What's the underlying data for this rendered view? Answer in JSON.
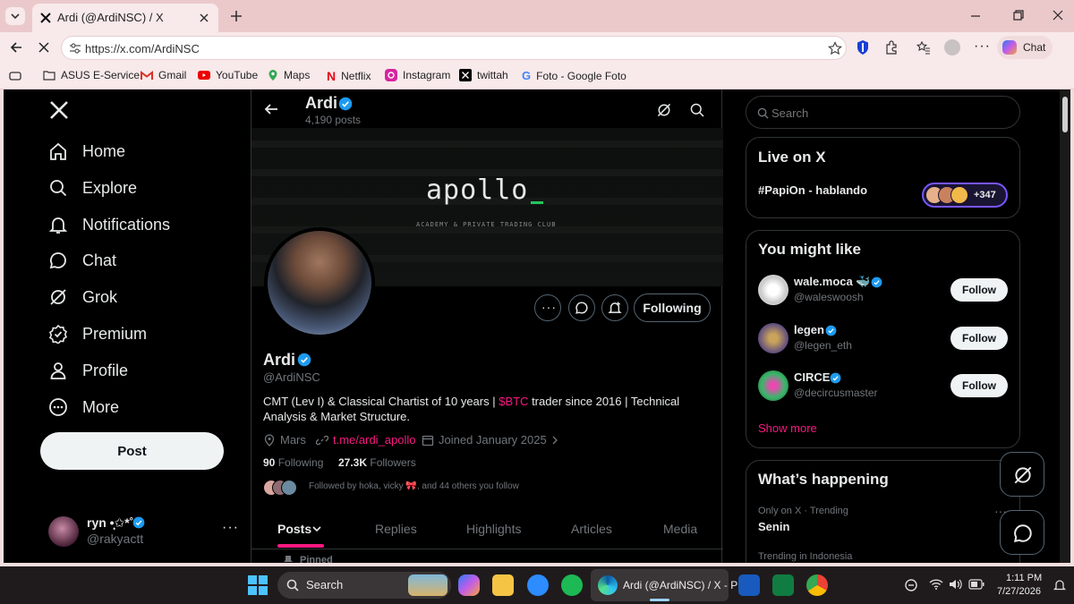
{
  "browser": {
    "tab_title": "Ardi (@ArdiNSC) / X",
    "url": "https://x.com/ArdiNSC",
    "chat_label": "Chat",
    "bookmarks": [
      "ASUS E-Service",
      "Gmail",
      "YouTube",
      "Maps",
      "Netflix",
      "Instagram",
      "twittah",
      "Foto - Google Foto"
    ]
  },
  "sidebar": {
    "items": [
      "Home",
      "Explore",
      "Notifications",
      "Chat",
      "Grok",
      "Premium",
      "Profile",
      "More"
    ],
    "post_label": "Post",
    "account_name": "ryn •̩͙✩*˚",
    "account_handle": "@rakyactt",
    "more_dots": "···"
  },
  "header": {
    "name": "Ardi",
    "posts_count": "4,190 posts"
  },
  "banner": {
    "logo": "apollo",
    "tagline": "ACADEMY & PRIVATE TRADING CLUB"
  },
  "profile": {
    "name": "Ardi",
    "handle": "@ArdiNSC",
    "bio_1": "CMT (Lev I) & Classical Chartist of 10 years | ",
    "bio_cashtag": "$BTC",
    "bio_2": " trader since 2016 | Technical Analysis & Market Structure.",
    "location": "Mars",
    "link": "t.me/ardi_apollo",
    "joined": "Joined January 2025",
    "following_count": "90",
    "following_label": "Following",
    "followers_count": "27.3K",
    "followers_label": "Followers",
    "followed_by": "Followed by hoka, vicky 🎀, and 44 others you follow",
    "following_button": "Following",
    "more_dots": "···"
  },
  "tabs": [
    "Posts",
    "Replies",
    "Highlights",
    "Articles",
    "Media"
  ],
  "pinned_label": "Pinned",
  "right": {
    "search_placeholder": "Search",
    "live": {
      "title": "Live on X",
      "topic": "#PapiOn - hablando",
      "count": "+347"
    },
    "suggest": {
      "title": "You might like",
      "users": [
        {
          "name": "wale.moca 🐳",
          "handle": "@waleswoosh",
          "button": "Follow"
        },
        {
          "name": "legen",
          "handle": "@legen_eth",
          "button": "Follow"
        },
        {
          "name": "CIRCE",
          "handle": "@decircusmaster",
          "button": "Follow"
        }
      ],
      "show_more": "Show more"
    },
    "happening": {
      "title": "What’s happening",
      "trend_context": "Only on X · Trending",
      "trend_name": "Senin",
      "trend2_context": "Trending in Indonesia",
      "dots": "···"
    }
  },
  "taskbar": {
    "search": "Search",
    "app_label": "Ardi (@ArdiNSC) / X - P",
    "time": "1:11 PM",
    "date": "7/27/2026"
  },
  "colors": {
    "accent": "#1d9bf0",
    "cashtag": "#f91880",
    "tab_underline": "#f91880",
    "link": "#f91880"
  }
}
